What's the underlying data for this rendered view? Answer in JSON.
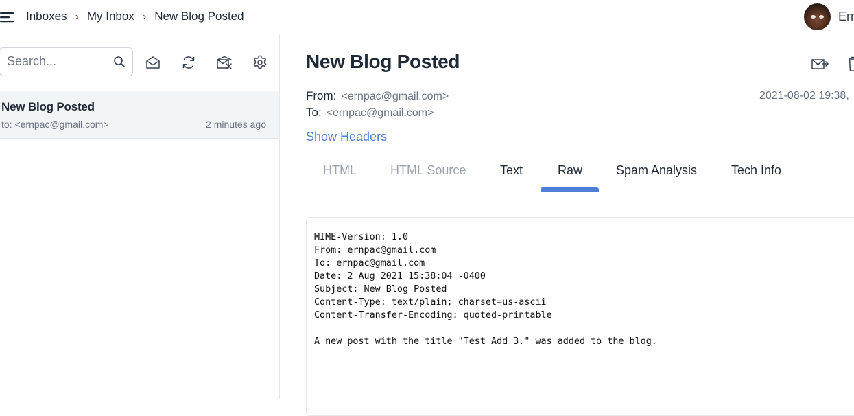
{
  "header": {
    "menu_icon": "hamburger-icon",
    "breadcrumb": [
      "Inboxes",
      "My Inbox",
      "New Blog Posted"
    ],
    "separator": "›",
    "user_name": "Ern"
  },
  "sidebar": {
    "search": {
      "placeholder": "Search...",
      "value": ""
    },
    "toolbar_icons": [
      "mark-read-icon",
      "refresh-icon",
      "clear-inbox-icon",
      "settings-icon"
    ],
    "messages": [
      {
        "subject": "New Blog Posted",
        "to": "to: <ernpac@gmail.com>",
        "time": "2 minutes ago",
        "selected": true
      }
    ]
  },
  "message": {
    "subject": "New Blog Posted",
    "from_label": "From:",
    "from": "<ernpac@gmail.com>",
    "to_label": "To:",
    "to": "<ernpac@gmail.com>",
    "date": "2021-08-02 19:38,",
    "show_headers": "Show Headers",
    "actions": [
      "forward-icon",
      "delete-icon"
    ],
    "tabs": [
      {
        "label": "HTML",
        "state": "muted"
      },
      {
        "label": "HTML Source",
        "state": "muted"
      },
      {
        "label": "Text",
        "state": "normal"
      },
      {
        "label": "Raw",
        "state": "active"
      },
      {
        "label": "Spam Analysis",
        "state": "normal"
      },
      {
        "label": "Tech Info",
        "state": "normal"
      }
    ],
    "raw": "MIME-Version: 1.0\nFrom: ernpac@gmail.com\nTo: ernpac@gmail.com\nDate: 2 Aug 2021 15:38:04 -0400\nSubject: New Blog Posted\nContent-Type: text/plain; charset=us-ascii\nContent-Transfer-Encoding: quoted-printable\n\nA new post with the title \"Test Add 3.\" was added to the blog."
  },
  "colors": {
    "accent": "#4f7fd8",
    "selected_row": "#f2f5f6",
    "border": "#e5e7eb",
    "muted_text": "#6b7280"
  }
}
